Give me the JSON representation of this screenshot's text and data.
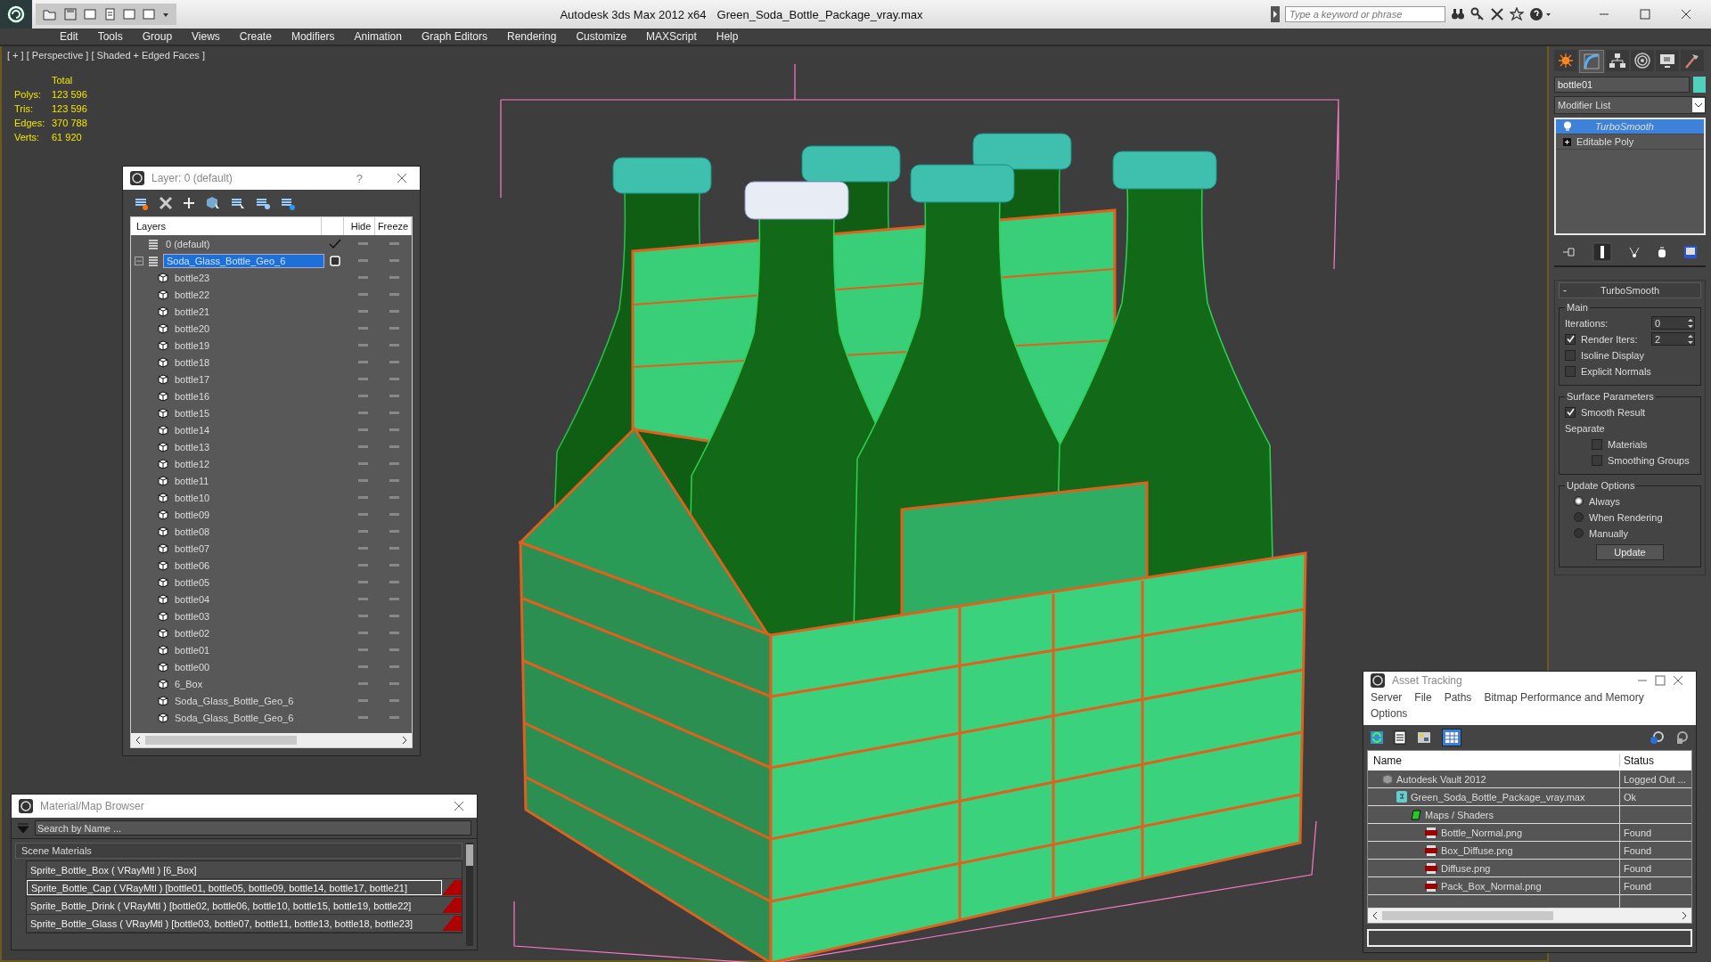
{
  "title_bar": {
    "app_title": "Autodesk 3ds Max  2012 x64",
    "file_name": "Green_Soda_Bottle_Package_vray.max",
    "search_placeholder": "Type a keyword or phrase"
  },
  "menu": [
    "Edit",
    "Tools",
    "Group",
    "Views",
    "Create",
    "Modifiers",
    "Animation",
    "Graph Editors",
    "Rendering",
    "Customize",
    "MAXScript",
    "Help"
  ],
  "viewport": {
    "label": "[ + ] [ Perspective ] [ Shaded + Edged Faces ]",
    "stats_heading": "Total",
    "stats": [
      {
        "label": "Polys:",
        "value": "123 596"
      },
      {
        "label": "Tris:",
        "value": "123 596"
      },
      {
        "label": "Edges:",
        "value": "370 788"
      },
      {
        "label": "Verts:",
        "value": "61 920"
      }
    ]
  },
  "layer_window": {
    "title": "Layer: 0 (default)",
    "help": "?",
    "columns": [
      "Layers",
      "Hide",
      "Freeze"
    ],
    "layers": [
      {
        "name": "0 (default)",
        "current": true,
        "selected": false
      },
      {
        "name": "Soda_Glass_Bottle_Geo_6",
        "current": false,
        "selected": true,
        "expanded": true,
        "children": [
          "bottle23",
          "bottle22",
          "bottle21",
          "bottle20",
          "bottle19",
          "bottle18",
          "bottle17",
          "bottle16",
          "bottle15",
          "bottle14",
          "bottle13",
          "bottle12",
          "bottle11",
          "bottle10",
          "bottle09",
          "bottle08",
          "bottle07",
          "bottle06",
          "bottle05",
          "bottle04",
          "bottle03",
          "bottle02",
          "bottle01",
          "bottle00",
          "6_Box",
          "Soda_Glass_Bottle_Geo_6",
          "Soda_Glass_Bottle_Geo_6"
        ]
      }
    ]
  },
  "material_browser": {
    "title": "Material/Map Browser",
    "search_placeholder": "Search by Name ...",
    "section": "Scene Materials",
    "materials": [
      {
        "text": "Sprite_Bottle_Box  ( VRayMtl )  [6_Box]",
        "selected": false,
        "flagged": false
      },
      {
        "text": "Sprite_Bottle_Cap  ( VRayMtl ) [bottle01, bottle05, bottle09, bottle14, bottle17, bottle21]",
        "selected": true,
        "flagged": true
      },
      {
        "text": "Sprite_Bottle_Drink  ( VRayMtl ) [bottle02, bottle06, bottle10, bottle15, bottle19, bottle22]",
        "selected": false,
        "flagged": true
      },
      {
        "text": "Sprite_Bottle_Glass  ( VRayMtl ) [bottle03, bottle07, bottle11, bottle13, bottle18, bottle23]",
        "selected": false,
        "flagged": true
      }
    ]
  },
  "asset_tracking": {
    "title": "Asset Tracking",
    "menu": [
      "Server",
      "File",
      "Paths",
      "Bitmap Performance and Memory",
      "Options"
    ],
    "columns": [
      "Name",
      "Status"
    ],
    "rows": [
      {
        "kind": "vault",
        "name": "Autodesk Vault 2012",
        "status": "Logged Out ...",
        "children": [
          {
            "kind": "max",
            "name": "Green_Soda_Bottle_Package_vray.max",
            "status": "Ok",
            "children": [
              {
                "kind": "folder",
                "name": "Maps / Shaders",
                "children": [
                  {
                    "kind": "png",
                    "name": "Bottle_Normal.png",
                    "status": "Found"
                  },
                  {
                    "kind": "png",
                    "name": "Box_Diffuse.png",
                    "status": "Found"
                  },
                  {
                    "kind": "png",
                    "name": "Diffuse.png",
                    "status": "Found"
                  },
                  {
                    "kind": "png",
                    "name": "Pack_Box_Normal.png",
                    "status": "Found"
                  }
                ]
              }
            ]
          }
        ]
      }
    ]
  },
  "command_panel": {
    "tabs": [
      {
        "kind": "create",
        "selected": false
      },
      {
        "kind": "modify",
        "selected": true
      },
      {
        "kind": "hierarchy",
        "selected": false
      },
      {
        "kind": "motion",
        "selected": false
      },
      {
        "kind": "display",
        "selected": false
      },
      {
        "kind": "utilities",
        "selected": false
      }
    ],
    "object_name": "bottle01",
    "modifier_list": "Modifier List",
    "stack": [
      {
        "kind": "modifier",
        "name": "TurboSmooth",
        "selected": true
      },
      {
        "kind": "base",
        "name": "Editable Poly",
        "selected": false
      }
    ],
    "rollout": {
      "title": "TurboSmooth",
      "collapse": "-",
      "groups": [
        {
          "title": "Main",
          "controls": [
            {
              "kind": "spinner",
              "label": "Iterations:",
              "value": "0"
            },
            {
              "kind": "checkbox_spinner",
              "label": "Render Iters:",
              "value": "2",
              "checked": true
            },
            {
              "kind": "checkbox",
              "label": "Isoline Display",
              "checked": false
            },
            {
              "kind": "checkbox",
              "label": "Explicit Normals",
              "checked": false
            }
          ]
        },
        {
          "title": "Surface Parameters",
          "controls": [
            {
              "kind": "checkbox",
              "label": "Smooth Result",
              "checked": true
            },
            {
              "kind": "label",
              "label": "Separate"
            },
            {
              "kind": "subcheckbox",
              "label": "Materials",
              "checked": false
            },
            {
              "kind": "subcheckbox",
              "label": "Smoothing Groups",
              "checked": false
            }
          ]
        },
        {
          "title": "Update Options",
          "controls": [
            {
              "kind": "radio",
              "label": "Always",
              "selected": true
            },
            {
              "kind": "radio",
              "label": "When Rendering",
              "selected": false
            },
            {
              "kind": "radio",
              "label": "Manually",
              "selected": false
            },
            {
              "kind": "button",
              "label": "Update"
            }
          ]
        }
      ]
    }
  }
}
